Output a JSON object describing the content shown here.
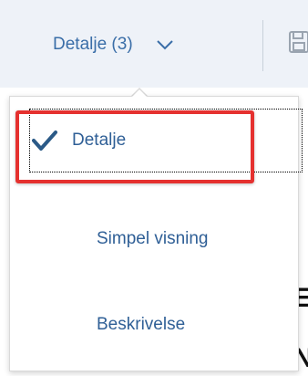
{
  "toolbar": {
    "view_button_label": "Detalje (3)",
    "icons": {
      "chevron": "chevron-down-icon",
      "save": "save-icon"
    },
    "accent_color": "#3a6ea8"
  },
  "view_menu": {
    "items": [
      {
        "label": "Detalje",
        "selected": true
      },
      {
        "label": "Simpel visning",
        "selected": false
      },
      {
        "label": "Beskrivelse",
        "selected": false
      }
    ],
    "selected_icon": "checkmark-icon",
    "check_color": "#2b5a87"
  },
  "background": {
    "glyph_right_1": "E",
    "glyph_right_2": "N"
  },
  "annotation": {
    "highlight_color": "#e5312f"
  }
}
